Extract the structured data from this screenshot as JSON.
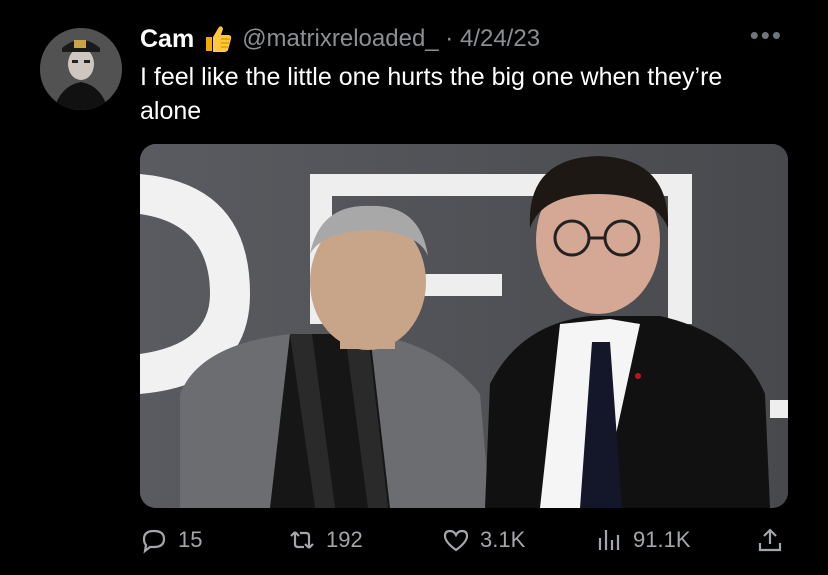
{
  "tweet": {
    "display_name": "Cam",
    "handle_date": "@matrixreloaded_ · 4/24/23",
    "text": "I feel like the little one hurts the big one when they’re alone",
    "more_label": "•••"
  },
  "media": {
    "description_icon": "photo-two-men"
  },
  "actions": {
    "replies": "15",
    "retweets": "192",
    "likes": "3.1K",
    "views": "91.1K"
  },
  "colors": {
    "background": "#000000",
    "text": "#ffffff",
    "secondary": "#8b8f94"
  }
}
